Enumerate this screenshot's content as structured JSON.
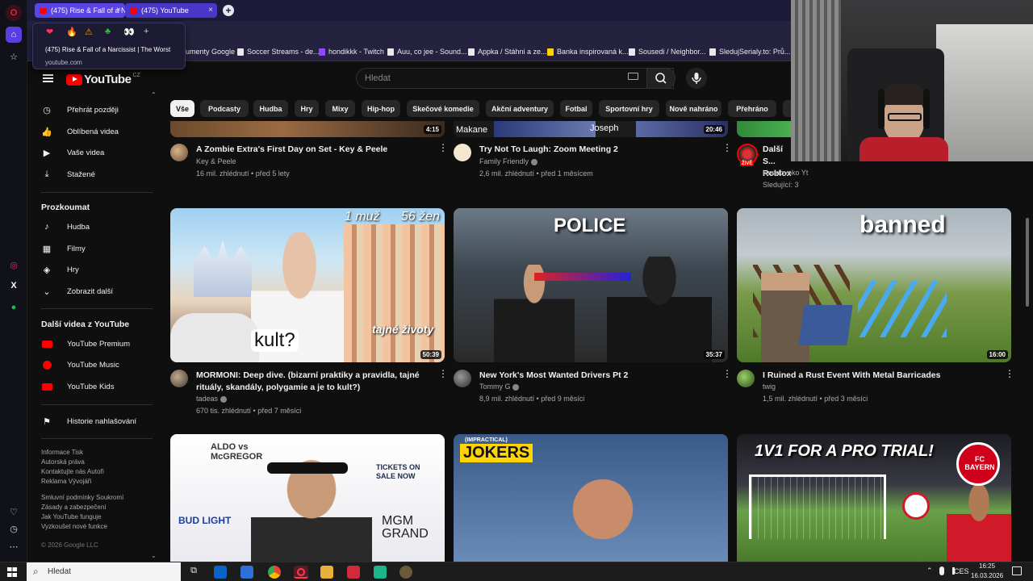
{
  "browser": {
    "tabs": [
      {
        "label": "(475) Rise & Fall of a Narcissist | The Worst"
      },
      {
        "label": "(475) YouTube"
      }
    ],
    "tab_preview": {
      "title": "(475) Rise & Fall of a Narcissist | The Worst",
      "domain": "youtube.com"
    },
    "bookmarks": [
      "umenty Google",
      "Soccer Streams - de...",
      "hondikkk - Twitch",
      "Auu, co jee - Sound...",
      "Appka / Stáhni a ze...",
      "Banka inspirovaná k...",
      "Sousedi / Neighbor...",
      "SledujSerialy.to: Prů..."
    ]
  },
  "youtube": {
    "logo_text": "YouTube",
    "region": "CZ",
    "search_placeholder": "Hledat",
    "nav": {
      "you": [
        "Přehrát později",
        "Oblíbená videa",
        "Vaše videa",
        "Stažené"
      ],
      "explore_title": "Prozkoumat",
      "explore": [
        "Hudba",
        "Filmy",
        "Hry",
        "Zobrazit další"
      ],
      "more_title": "Další videa z YouTube",
      "more": [
        "YouTube Premium",
        "YouTube Music",
        "YouTube Kids"
      ],
      "report": "Historie nahlašování",
      "footer": [
        "Informace  Tisk",
        "Autorská práva",
        "Kontaktujte nás  Autoři",
        "Reklama  Vývojáři",
        "Smluvní podmínky  Soukromí",
        "Zásady a zabezpečení",
        "Jak YouTube funguje",
        "Vyzkoušet nové funkce"
      ],
      "copyright": "© 2026 Google LLC"
    },
    "chips": [
      "Vše",
      "Podcasty",
      "Hudba",
      "Hry",
      "Mixy",
      "Hip-hop",
      "Skečové komedie",
      "Akční adventury",
      "Fotbal",
      "Sportovní hry",
      "Nově nahráno",
      "Přehráno",
      "P"
    ],
    "videos_row0": [
      {
        "title": "A Zombie Extra's First Day on Set - Key & Peele",
        "channel": "Key & Peele",
        "meta": "16 mil. zhlédnutí • před 5 lety",
        "duration": "4:15"
      },
      {
        "title": "Try Not To Laugh: Zoom Meeting 2",
        "channel": "Family Friendly",
        "meta": "2,6 mil. zhlédnutí • před 1 měsícem",
        "duration": "20:46",
        "overlay_left": "Makane",
        "overlay_right": "Joseph"
      },
      {
        "title": "Další S... Roblox...",
        "channel": "Hnedovoko Yt",
        "meta": "Sledující: 3",
        "badge": "ŽIVĚ"
      }
    ],
    "videos_row1": [
      {
        "title": "MORMONI: Deep dive. (bizarní praktiky a pravidla, tajné rituály, skandály, polygamie a je to kult?)",
        "channel": "tadeas",
        "meta": "670 tis. zhlédnutí • před 7 měsíci",
        "duration": "50:39",
        "thumb_text": [
          "1 muž",
          "56 žen",
          "kult?",
          "tajné životy"
        ]
      },
      {
        "title": "New York's Most Wanted Drivers Pt 2",
        "channel": "Tommy G",
        "meta": "8,9 mil. zhlédnutí • před 9 měsíci",
        "duration": "35:37",
        "thumb_text": [
          "POLICE"
        ]
      },
      {
        "title": "I Ruined a Rust Event With Metal Barricades",
        "channel": "twig",
        "meta": "1,5 mil. zhlédnutí • před 3 měsíci",
        "duration": "16:00",
        "thumb_text": [
          "banned"
        ]
      }
    ],
    "videos_row2_thumb_text": [
      [
        "ALDO vs McGREGOR",
        "TICKETS ON SALE NOW",
        "MGM GRAND",
        "BUD LIGHT"
      ],
      [
        "(IMPRACTICAL)",
        "JOKERS"
      ],
      [
        "1V1 FOR A PRO TRIAL!",
        "FC BAYERN"
      ]
    ]
  },
  "taskbar": {
    "search_placeholder": "Hledat",
    "language": "CES",
    "time": "16:25",
    "date": "16.03.2026"
  },
  "colors": {
    "accent": "#ff0000",
    "bg": "#0f0f0f",
    "chip": "#272727",
    "tabstrip": "#1d1a3a"
  }
}
